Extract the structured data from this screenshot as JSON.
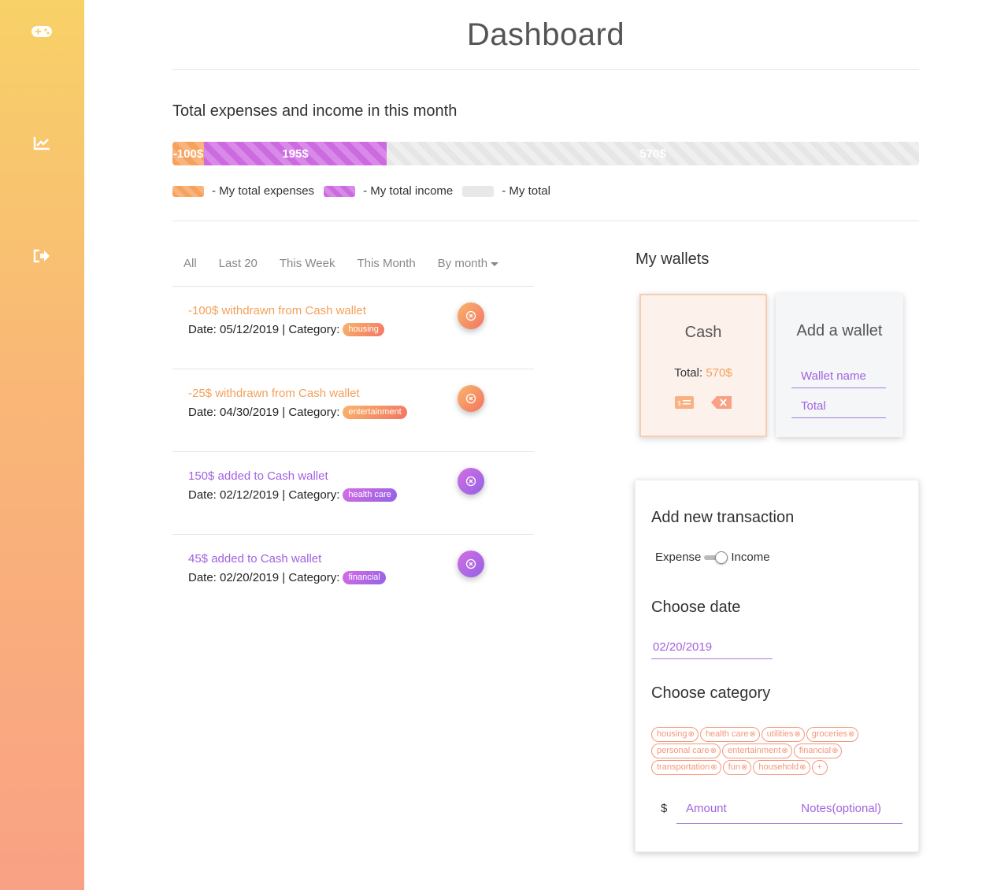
{
  "sidebar": {
    "icons": [
      "gamepad-icon",
      "chart-line-icon",
      "sign-out-icon"
    ]
  },
  "page": {
    "title": "Dashboard",
    "summary_title": "Total expenses and income in this month"
  },
  "progress": {
    "expenses_label": "-100$",
    "income_label": "195$",
    "total_label": "570$",
    "expenses_value": -100,
    "income_value": 195,
    "total_value": 570
  },
  "legend": {
    "expenses": "- My total expenses",
    "income": "- My total income",
    "total": "- My total"
  },
  "tabs": [
    "All",
    "Last 20",
    "This Week",
    "This Month",
    "By month"
  ],
  "transactions": [
    {
      "title": "-100$ withdrawn from Cash wallet",
      "date": "Date: 05/12/2019 | Category:",
      "category": "housing",
      "type": "expense"
    },
    {
      "title": "-25$ withdrawn from Cash wallet",
      "date": "Date: 04/30/2019 | Category:",
      "category": "entertainment",
      "type": "expense"
    },
    {
      "title": "150$ added to Cash wallet",
      "date": "Date: 02/12/2019 | Category:",
      "category": "health care",
      "type": "income"
    },
    {
      "title": "45$ added to Cash wallet",
      "date": "Date: 02/20/2019 | Category:",
      "category": "financial",
      "type": "income"
    }
  ],
  "wallets": {
    "title": "My wallets",
    "cash": {
      "name": "Cash",
      "total_label": "Total:",
      "total_value": "570$"
    },
    "add": {
      "title": "Add a wallet",
      "name_placeholder": "Wallet name",
      "total_placeholder": "Total"
    }
  },
  "form": {
    "title": "Add new transaction",
    "expense_label": "Expense",
    "income_label": "Income",
    "date_title": "Choose date",
    "date_value": "02/20/2019",
    "category_title": "Choose category",
    "categories": [
      "housing",
      "health care",
      "utilities",
      "groceries",
      "personal care",
      "entertainment",
      "financial",
      "transportation",
      "fun",
      "household"
    ],
    "add_chip": "+",
    "currency": "$",
    "amount_placeholder": "Amount",
    "notes_placeholder": "Notes(optional)"
  },
  "colors": {
    "expense": "#f4a05a",
    "income": "#a262e0",
    "sidebar_top": "#f8d167",
    "sidebar_bottom": "#f9a184"
  }
}
